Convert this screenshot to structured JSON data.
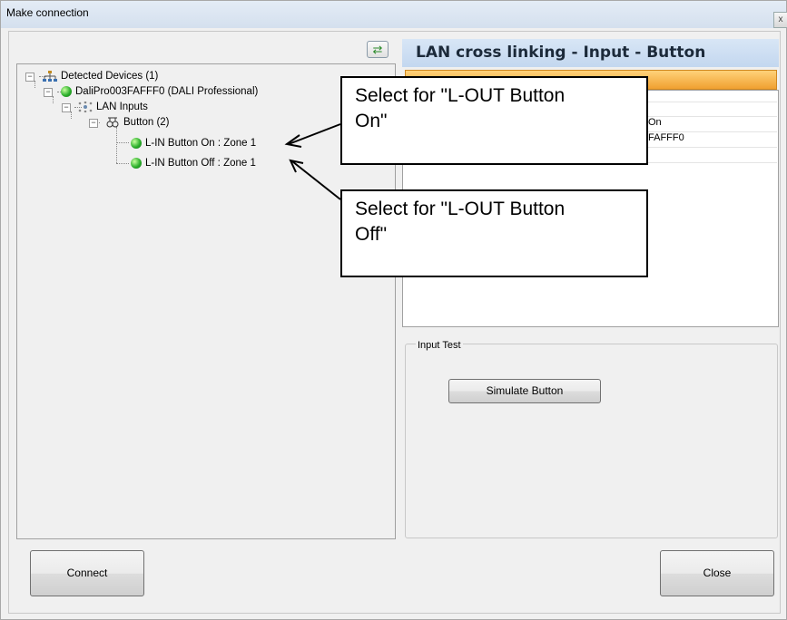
{
  "window": {
    "title": "Make connection",
    "close_glyph": "x"
  },
  "toolbar": {
    "refresh_icon": "refresh-icon",
    "refresh_glyph": "⇄"
  },
  "tree": {
    "root": {
      "label": "Detected Devices (1)",
      "icon": "network-icon",
      "expander": "−"
    },
    "device": {
      "label": "DaliPro003FAFFF0 (DALI Professional)",
      "icon": "green-status-icon",
      "expander": "−"
    },
    "lan_inputs": {
      "label": "LAN Inputs",
      "icon": "lan-inputs-icon",
      "expander": "−"
    },
    "button_group": {
      "label": "Button (2)",
      "icon": "button-icon",
      "expander": "−"
    },
    "items": [
      {
        "label": "L-IN Button On : Zone 1",
        "icon": "green-status-icon"
      },
      {
        "label": "L-IN Button Off : Zone 1",
        "icon": "green-status-icon"
      }
    ]
  },
  "details": {
    "header": "LAN cross linking - Input - Button",
    "visible_values": [
      "On",
      "FAFFF0"
    ]
  },
  "input_test": {
    "label": "Input Test",
    "simulate_button": "Simulate Button"
  },
  "footer": {
    "connect_button": "Connect",
    "close_button": "Close"
  },
  "callouts": [
    {
      "line1": "Select for \"L-OUT Button",
      "line2": "On\""
    },
    {
      "line1": "Select for \"L-OUT Button",
      "line2": "Off\""
    }
  ]
}
